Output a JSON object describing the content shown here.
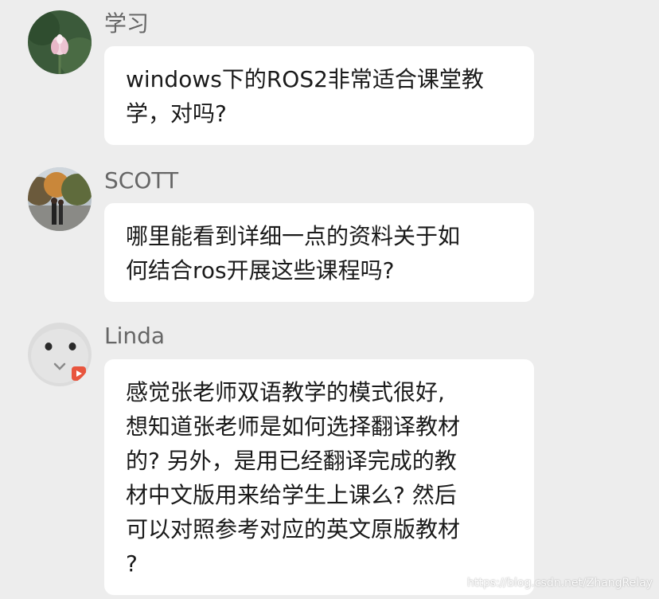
{
  "messages": [
    {
      "name": "学习",
      "avatar": "lotus-avatar",
      "lines": [
        "windows下的ROS2非常适合课堂教",
        "学，对吗?"
      ]
    },
    {
      "name": "SCOTT",
      "avatar": "park-photo-avatar",
      "lines": [
        "哪里能看到详细一点的资料关于如",
        "何结合ros开展这些课程吗?"
      ]
    },
    {
      "name": "Linda",
      "avatar": "cartoon-face-avatar",
      "lines": [
        "感觉张老师双语教学的模式很好,",
        "想知道张老师是如何选择翻译教材",
        "的? 另外，是用已经翻译完成的教",
        "材中文版用来给学生上课么? 然后",
        "可以对照参考对应的英文原版教材",
        "?"
      ]
    }
  ],
  "watermark": "https://blog.csdn.net/ZhangRelay",
  "colors": {
    "background": "#ededed",
    "bubble": "#ffffff",
    "name_text": "#666666",
    "message_text": "#1a1a1a"
  }
}
